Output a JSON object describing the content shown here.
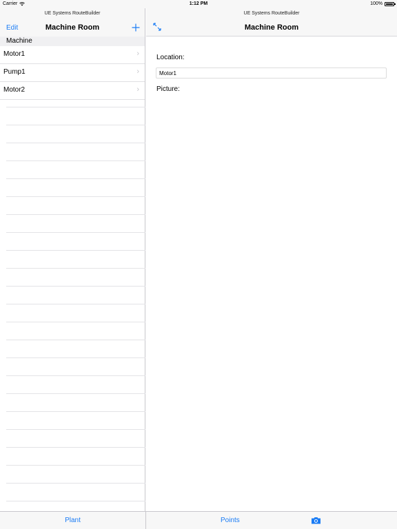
{
  "status": {
    "carrier": "Carrier",
    "time": "1:12 PM",
    "battery": "100%"
  },
  "master": {
    "subtitle": "UE Systems RouteBuilder",
    "title": "Machine Room",
    "edit_label": "Edit",
    "add_icon": "plus-icon",
    "section_header": "Machine",
    "items": [
      {
        "label": "Motor1"
      },
      {
        "label": "Pump1"
      },
      {
        "label": "Motor2"
      }
    ]
  },
  "detail": {
    "subtitle": "UE Systems RouteBuilder",
    "title": "Machine Room",
    "expand_icon": "expand-arrows-icon",
    "location_label": "Location:",
    "location_value": "Motor1",
    "picture_label": "Picture:"
  },
  "tabbar": {
    "plant_label": "Plant",
    "points_label": "Points",
    "camera_icon": "camera-icon"
  },
  "colors": {
    "accent": "#1a7cf5",
    "bar_background": "#f7f7f7",
    "separator": "#c8c7cc"
  }
}
